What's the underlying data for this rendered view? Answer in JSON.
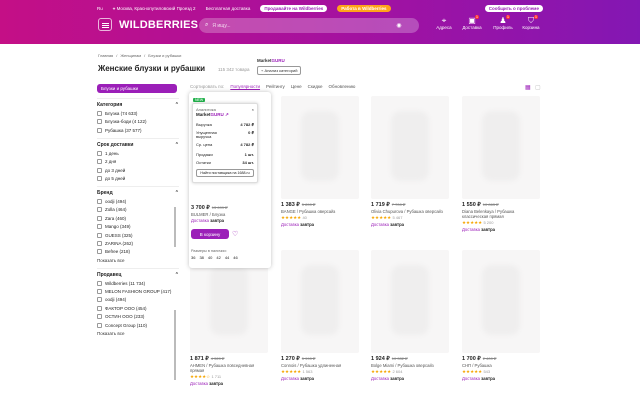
{
  "header": {
    "region": "Ru",
    "address": "Москва, Краснопутиловский Проезд 2",
    "free_delivery": "Бесплатная доставка",
    "sell_btn": "Продавайте на Wildberries",
    "work_btn": "Работа в Wildberries",
    "report_btn": "Сообщить о проблеме",
    "logo": "WILDBERRIES",
    "search_placeholder": "Я ищу...",
    "icons": [
      {
        "label": "Адреса",
        "icon": "pin-icon",
        "badge": ""
      },
      {
        "label": "Доставка",
        "icon": "box-icon",
        "badge": "1"
      },
      {
        "label": "Профиль",
        "icon": "person-icon",
        "badge": "1"
      },
      {
        "label": "Корзина",
        "icon": "bag-icon",
        "badge": "1"
      }
    ]
  },
  "breadcrumb": [
    "Главная",
    "Женщинам",
    "Блузки и рубашки"
  ],
  "page": {
    "title": "Женские блузки и рубашки",
    "count": "115 342 товара"
  },
  "marketguru": {
    "brand_left": "Market",
    "brand_right": "GURU",
    "btn": "Анализ категорий"
  },
  "sort": {
    "label": "Сортировать по:",
    "options": [
      "Популярности",
      "Рейтингу",
      "Цене",
      "Скидке",
      "Обновлению"
    ],
    "active": 0
  },
  "sidebar": {
    "chip": "Блузки и рубашки",
    "category": {
      "title": "Категория",
      "items": [
        "Блузка (74 633)",
        "Блузка-боди (4 122)",
        "Рубашка (37 577)"
      ]
    },
    "delivery": {
      "title": "Срок доставки",
      "items": [
        "1 день",
        "2 дня",
        "до 3 дней",
        "до 5 дней"
      ]
    },
    "brand": {
      "title": "Бренд",
      "items": [
        "oodji (494)",
        "Zolla (464)",
        "Zara (460)",
        "Mango (349)",
        "GUESS (325)",
        "ZARINA (262)",
        "Befree (218)"
      ],
      "more": "Показать все"
    },
    "seller": {
      "title": "Продавец",
      "items": [
        "Wildberries (11 734)",
        "MELON FASHION GROUP (417)",
        "oodji (494)",
        "ФАКТОР ООО (454)",
        "ОСТИН ООО (233)",
        "Concept Group (110)"
      ],
      "more": "Показать все"
    }
  },
  "popup": {
    "new": "NEW",
    "title_small": "Аналитика",
    "brand_left": "Market",
    "brand_right": "GURU",
    "rows": [
      [
        "Выручка",
        "4 782 ₽"
      ],
      [
        "Упущенная выручка",
        "0 ₽"
      ],
      [
        "Ср. цена",
        "4 782 ₽"
      ],
      [
        "Продажи",
        "1 шт."
      ],
      [
        "Остатки",
        "34 шт."
      ]
    ],
    "btn": "Найти поставщика на 1688.ru",
    "price": "3 700 ₽",
    "old": "13 699 ₽",
    "brand": "BULMER / Блузка",
    "deliv_label": "Доставка",
    "deliv_day": "завтра",
    "cart": "В корзину",
    "sizes_label": "Размеры в наличии:",
    "sizes": [
      "36",
      "38",
      "40",
      "42",
      "44",
      "46"
    ]
  },
  "products": [
    {
      "price": "1 383 ₽",
      "old": "5 890 ₽",
      "brand": "BANGE / Рубашка оверсайз",
      "stars": "★★★★★",
      "reviews": "40",
      "deliv_label": "Доставка",
      "deliv_day": "завтра"
    },
    {
      "price": "1 719 ₽",
      "old": "7 700 ₽",
      "brand": "Olivia Chupurova / Рубашка оверсайз",
      "stars": "★★★★★",
      "reviews": "5 467",
      "deliv_label": "Доставка",
      "deliv_day": "завтра"
    },
    {
      "price": "1 550 ₽",
      "old": "10 863 ₽",
      "brand": "Diana Belenkaya / Рубашка классическая прямая",
      "stars": "★★★★★",
      "reviews": "5 200",
      "deliv_label": "Доставка",
      "deliv_day": "завтра"
    },
    {
      "price": "1 871 ₽",
      "old": "4 320 ₽",
      "brand": "AHMEN / Рубашка повседневная прямая",
      "stars": "★★★★☆",
      "reviews": "1 711",
      "deliv_label": "Доставка",
      "deliv_day": "завтра"
    },
    {
      "price": "1 270 ₽",
      "old": "5 990 ₽",
      "brand": "Connois / Рубашка удлиненная",
      "stars": "★★★★★",
      "reviews": "1 563",
      "deliv_label": "Доставка",
      "deliv_day": "завтра"
    },
    {
      "price": "1 924 ₽",
      "old": "10 332 ₽",
      "brand": "Bolge Miami / Рубашка оверсайз",
      "stars": "★★★★★",
      "reviews": "2 604",
      "deliv_label": "Доставка",
      "deliv_day": "завтра"
    },
    {
      "price": "1 700 ₽",
      "old": "2 400 ₽",
      "brand": "СНП / Рубашка",
      "stars": "★★★★★",
      "reviews": "543",
      "deliv_label": "Доставка",
      "deliv_day": "завтра"
    }
  ],
  "colors": {
    "brand_purple": "#9b1fb8",
    "star": "#f6a500"
  }
}
